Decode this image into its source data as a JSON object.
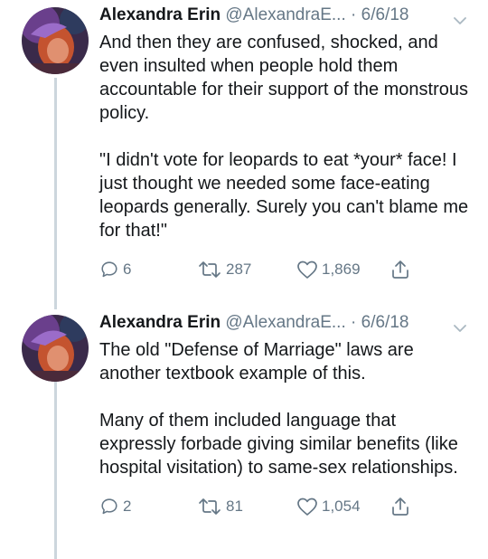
{
  "tweets": [
    {
      "author_name": "Alexandra Erin",
      "handle": "@AlexandraE...",
      "separator": "·",
      "date": "6/6/18",
      "paragraphs": [
        "And then they are confused, shocked, and even insulted when people hold them accountable for their support of the monstrous policy.",
        "\"I didn't vote for leopards to eat *your* face! I just thought we needed some face-eating leopards generally. Surely you can't blame me for that!\""
      ],
      "replies": "6",
      "retweets": "287",
      "likes": "1,869"
    },
    {
      "author_name": "Alexandra Erin",
      "handle": "@AlexandraE...",
      "separator": "·",
      "date": "6/6/18",
      "paragraphs": [
        "The old \"Defense of Marriage\" laws are another textbook example of this.",
        "Many of them included language that expressly forbade giving similar benefits (like hospital visitation) to same-sex relationships."
      ],
      "replies": "2",
      "retweets": "81",
      "likes": "1,054"
    }
  ],
  "icons": {
    "reply": "reply-icon",
    "retweet": "retweet-icon",
    "like": "heart-icon",
    "share": "share-icon",
    "caret": "chevron-down-icon"
  },
  "colors": {
    "text": "#14171a",
    "secondary": "#657786",
    "thread_line": "#ccd6dd",
    "background": "#ffffff"
  }
}
